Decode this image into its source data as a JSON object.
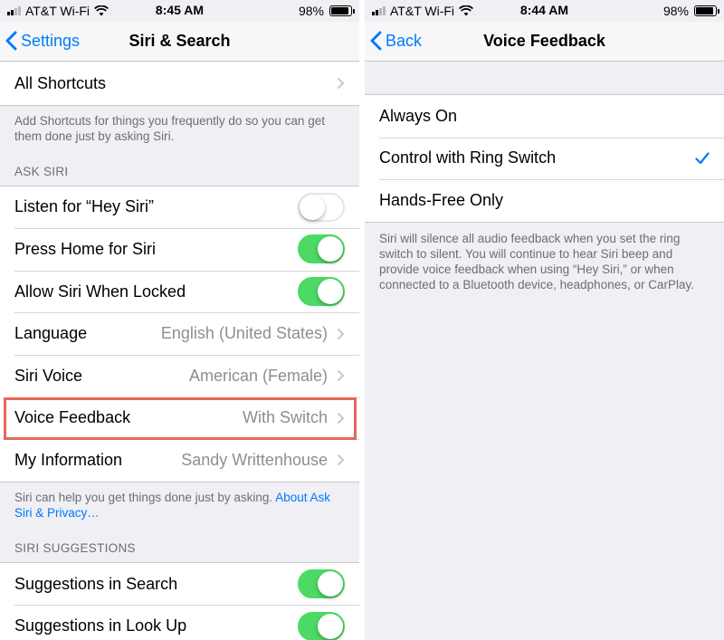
{
  "colors": {
    "accent": "#007aff",
    "toggle_on": "#4cd964",
    "highlight": "#e5675b"
  },
  "left": {
    "status": {
      "carrier": "AT&T Wi-Fi",
      "time": "8:45 AM",
      "battery": "98%"
    },
    "nav": {
      "back_label": "Settings",
      "title": "Siri & Search"
    },
    "shortcuts_row": {
      "label": "All Shortcuts"
    },
    "shortcuts_note": "Add Shortcuts for things you frequently do so you can get them done just by asking Siri.",
    "ask_siri_header": "ASK SIRI",
    "rows": {
      "hey_siri": {
        "label": "Listen for “Hey Siri”",
        "on": false
      },
      "press_home": {
        "label": "Press Home for Siri",
        "on": true
      },
      "allow_locked": {
        "label": "Allow Siri When Locked",
        "on": true
      },
      "language": {
        "label": "Language",
        "value": "English (United States)"
      },
      "siri_voice": {
        "label": "Siri Voice",
        "value": "American (Female)"
      },
      "voice_feedback": {
        "label": "Voice Feedback",
        "value": "With Switch"
      },
      "my_information": {
        "label": "My Information",
        "value": "Sandy Writtenhouse"
      }
    },
    "privacy_note": {
      "text": "Siri can help you get things done just by asking. ",
      "link": "About Ask Siri & Privacy…"
    },
    "suggestions_header": "SIRI SUGGESTIONS",
    "suggestion_rows": {
      "search": {
        "label": "Suggestions in Search",
        "on": true
      },
      "lookup": {
        "label": "Suggestions in Look Up",
        "on": true
      }
    }
  },
  "right": {
    "status": {
      "carrier": "AT&T Wi-Fi",
      "time": "8:44 AM",
      "battery": "98%"
    },
    "nav": {
      "back_label": "Back",
      "title": "Voice Feedback"
    },
    "options": [
      {
        "label": "Always On",
        "selected": false
      },
      {
        "label": "Control with Ring Switch",
        "selected": true
      },
      {
        "label": "Hands-Free Only",
        "selected": false
      }
    ],
    "note": "Siri will silence all audio feedback when you set the ring switch to silent. You will continue to hear Siri beep and provide voice feedback when using “Hey Siri,” or when connected to a Bluetooth device, headphones, or CarPlay."
  }
}
